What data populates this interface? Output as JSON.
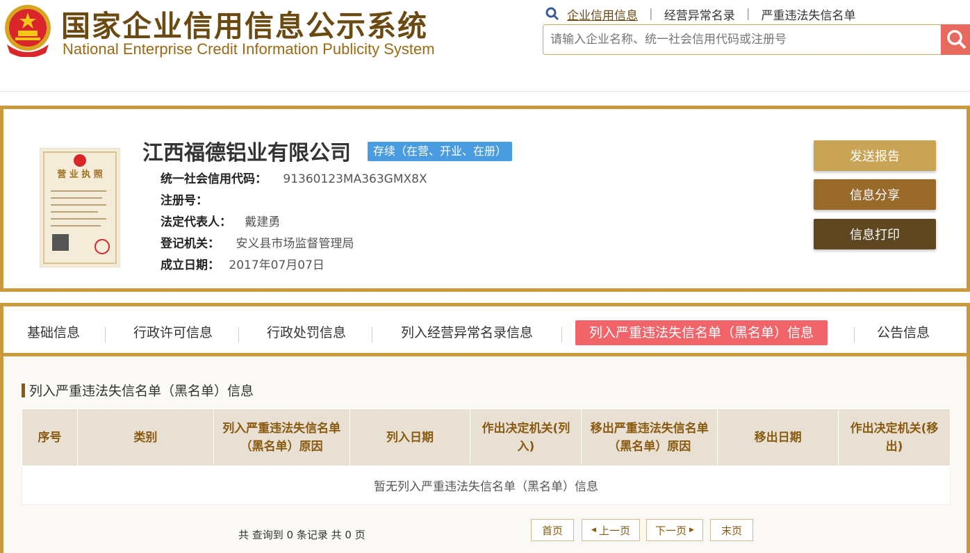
{
  "header": {
    "title_cn": "国家企业信用信息公示系统",
    "title_en": "National Enterprise Credit Information Publicity System",
    "nav": [
      "企业信用信息",
      "经营异常名录",
      "严重违法失信名单"
    ],
    "search_placeholder": "请输入企业名称、统一社会信用代码或注册号"
  },
  "company": {
    "name": "江西福德铝业有限公司",
    "status": "存续（在营、开业、在册）",
    "license_title": "营业执照",
    "fields": [
      {
        "label": "统一社会信用代码：",
        "value": "91360123MA363GMX8X"
      },
      {
        "label": "注册号：",
        "value": ""
      },
      {
        "label": "法定代表人：",
        "value": "戴建勇"
      },
      {
        "label": "登记机关：",
        "value": "安义县市场监督管理局"
      },
      {
        "label": "成立日期：",
        "value": "2017年07月07日"
      }
    ],
    "actions": [
      "发送报告",
      "信息分享",
      "信息打印"
    ]
  },
  "tabs": [
    "基础信息",
    "行政许可信息",
    "行政处罚信息",
    "列入经营异常名录信息",
    "列入严重违法失信名单（黑名单）信息",
    "公告信息"
  ],
  "section": {
    "title": "列入严重违法失信名单（黑名单）信息",
    "columns": [
      "序号",
      "类别",
      "列入严重违法失信名单（黑名单）原因",
      "列入日期",
      "作出决定机关(列入)",
      "移出严重违法失信名单（黑名单）原因",
      "移出日期",
      "作出决定机关(移出)"
    ],
    "empty_text": "暂无列入严重违法失信名单（黑名单）信息"
  },
  "pager": {
    "info": "共 查询到 0 条记录 共 0 页",
    "first": "首页",
    "prev": "上一页",
    "next": "下一页",
    "last": "末页"
  },
  "colors": {
    "brand_gold": "#c99a3c",
    "active_tab": "#f0646a",
    "status_blue": "#4a9ce0",
    "send_btn": "#c9a456",
    "share_btn": "#9a6a2a",
    "print_btn": "#5e4620"
  }
}
